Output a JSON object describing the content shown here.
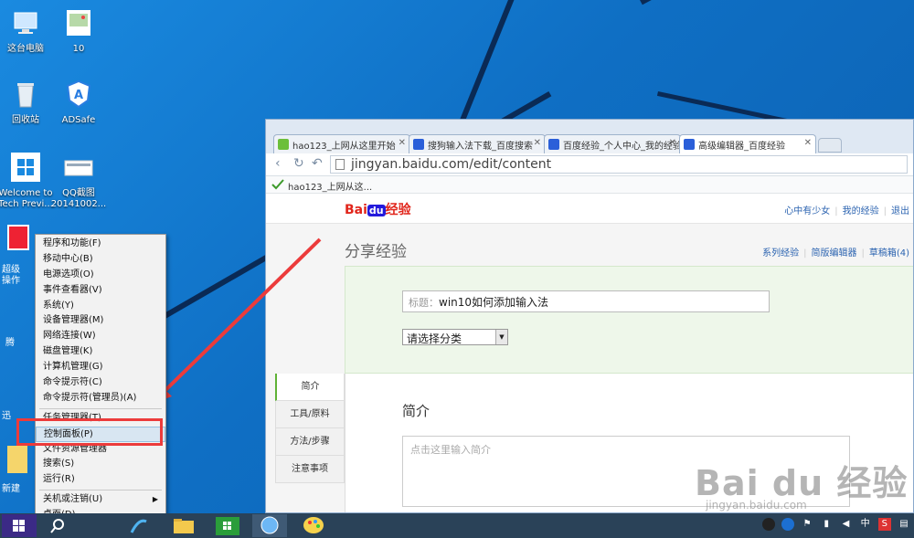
{
  "desktop": {
    "icons": [
      {
        "label": "这台电脑"
      },
      {
        "label": "10"
      },
      {
        "label": "回收站"
      },
      {
        "label": "ADSafe"
      },
      {
        "label": "Welcome to",
        "label2": "Tech Previ..."
      },
      {
        "label": "QQ截图",
        "label2": "20141002..."
      }
    ],
    "partial_labels": [
      "超级",
      "操作",
      "腾",
      "迅",
      "新建"
    ]
  },
  "browser": {
    "tabs": [
      {
        "title": "hao123_上网从这里开始"
      },
      {
        "title": "搜狗输入法下载_百度搜索"
      },
      {
        "title": "百度经验_个人中心_我的经验"
      },
      {
        "title": "高级编辑器_百度经验"
      }
    ],
    "url": "jingyan.baidu.com/edit/content",
    "bookmark": "hao123_上网从这..."
  },
  "site": {
    "logo": {
      "bai": "Bai",
      "du": "du",
      "jingyan": "经验"
    },
    "user_links": [
      "心中有少女",
      "我的经验",
      "退出"
    ],
    "heading": "分享经验",
    "sub_links": [
      "系列经验",
      "简版编辑器",
      "草稿箱(4)"
    ],
    "title_label": "标题：",
    "title_value": "win10如何添加输入法",
    "category_placeholder": "请选择分类",
    "side_tabs": [
      "简介",
      "工具/原料",
      "方法/步骤",
      "注意事项"
    ],
    "intro_heading": "简介",
    "intro_placeholder": "点击这里输入简介"
  },
  "context_menu": {
    "items": [
      "程序和功能(F)",
      "移动中心(B)",
      "电源选项(O)",
      "事件查看器(V)",
      "系统(Y)",
      "设备管理器(M)",
      "网络连接(W)",
      "磁盘管理(K)",
      "计算机管理(G)",
      "命令提示符(C)",
      "命令提示符(管理员)(A)"
    ],
    "items2": [
      "任务管理器(T)",
      "控制面板(P)",
      "文件资源管理器",
      "搜索(S)",
      "运行(R)"
    ],
    "items3": [
      "关机或注销(U)",
      "桌面(D)"
    ],
    "highlighted": "控制面板(P)"
  },
  "tray": {
    "ime": "中",
    "lang": "S"
  },
  "watermark": {
    "main": "Bai du 经验",
    "sub": "jingyan.baidu.com"
  },
  "colors": {
    "annotation_red": "#ec3b3b",
    "desktop_blue": "#1a8ae0",
    "baidu_red": "#e1251b",
    "baidu_blue": "#2319dc"
  }
}
